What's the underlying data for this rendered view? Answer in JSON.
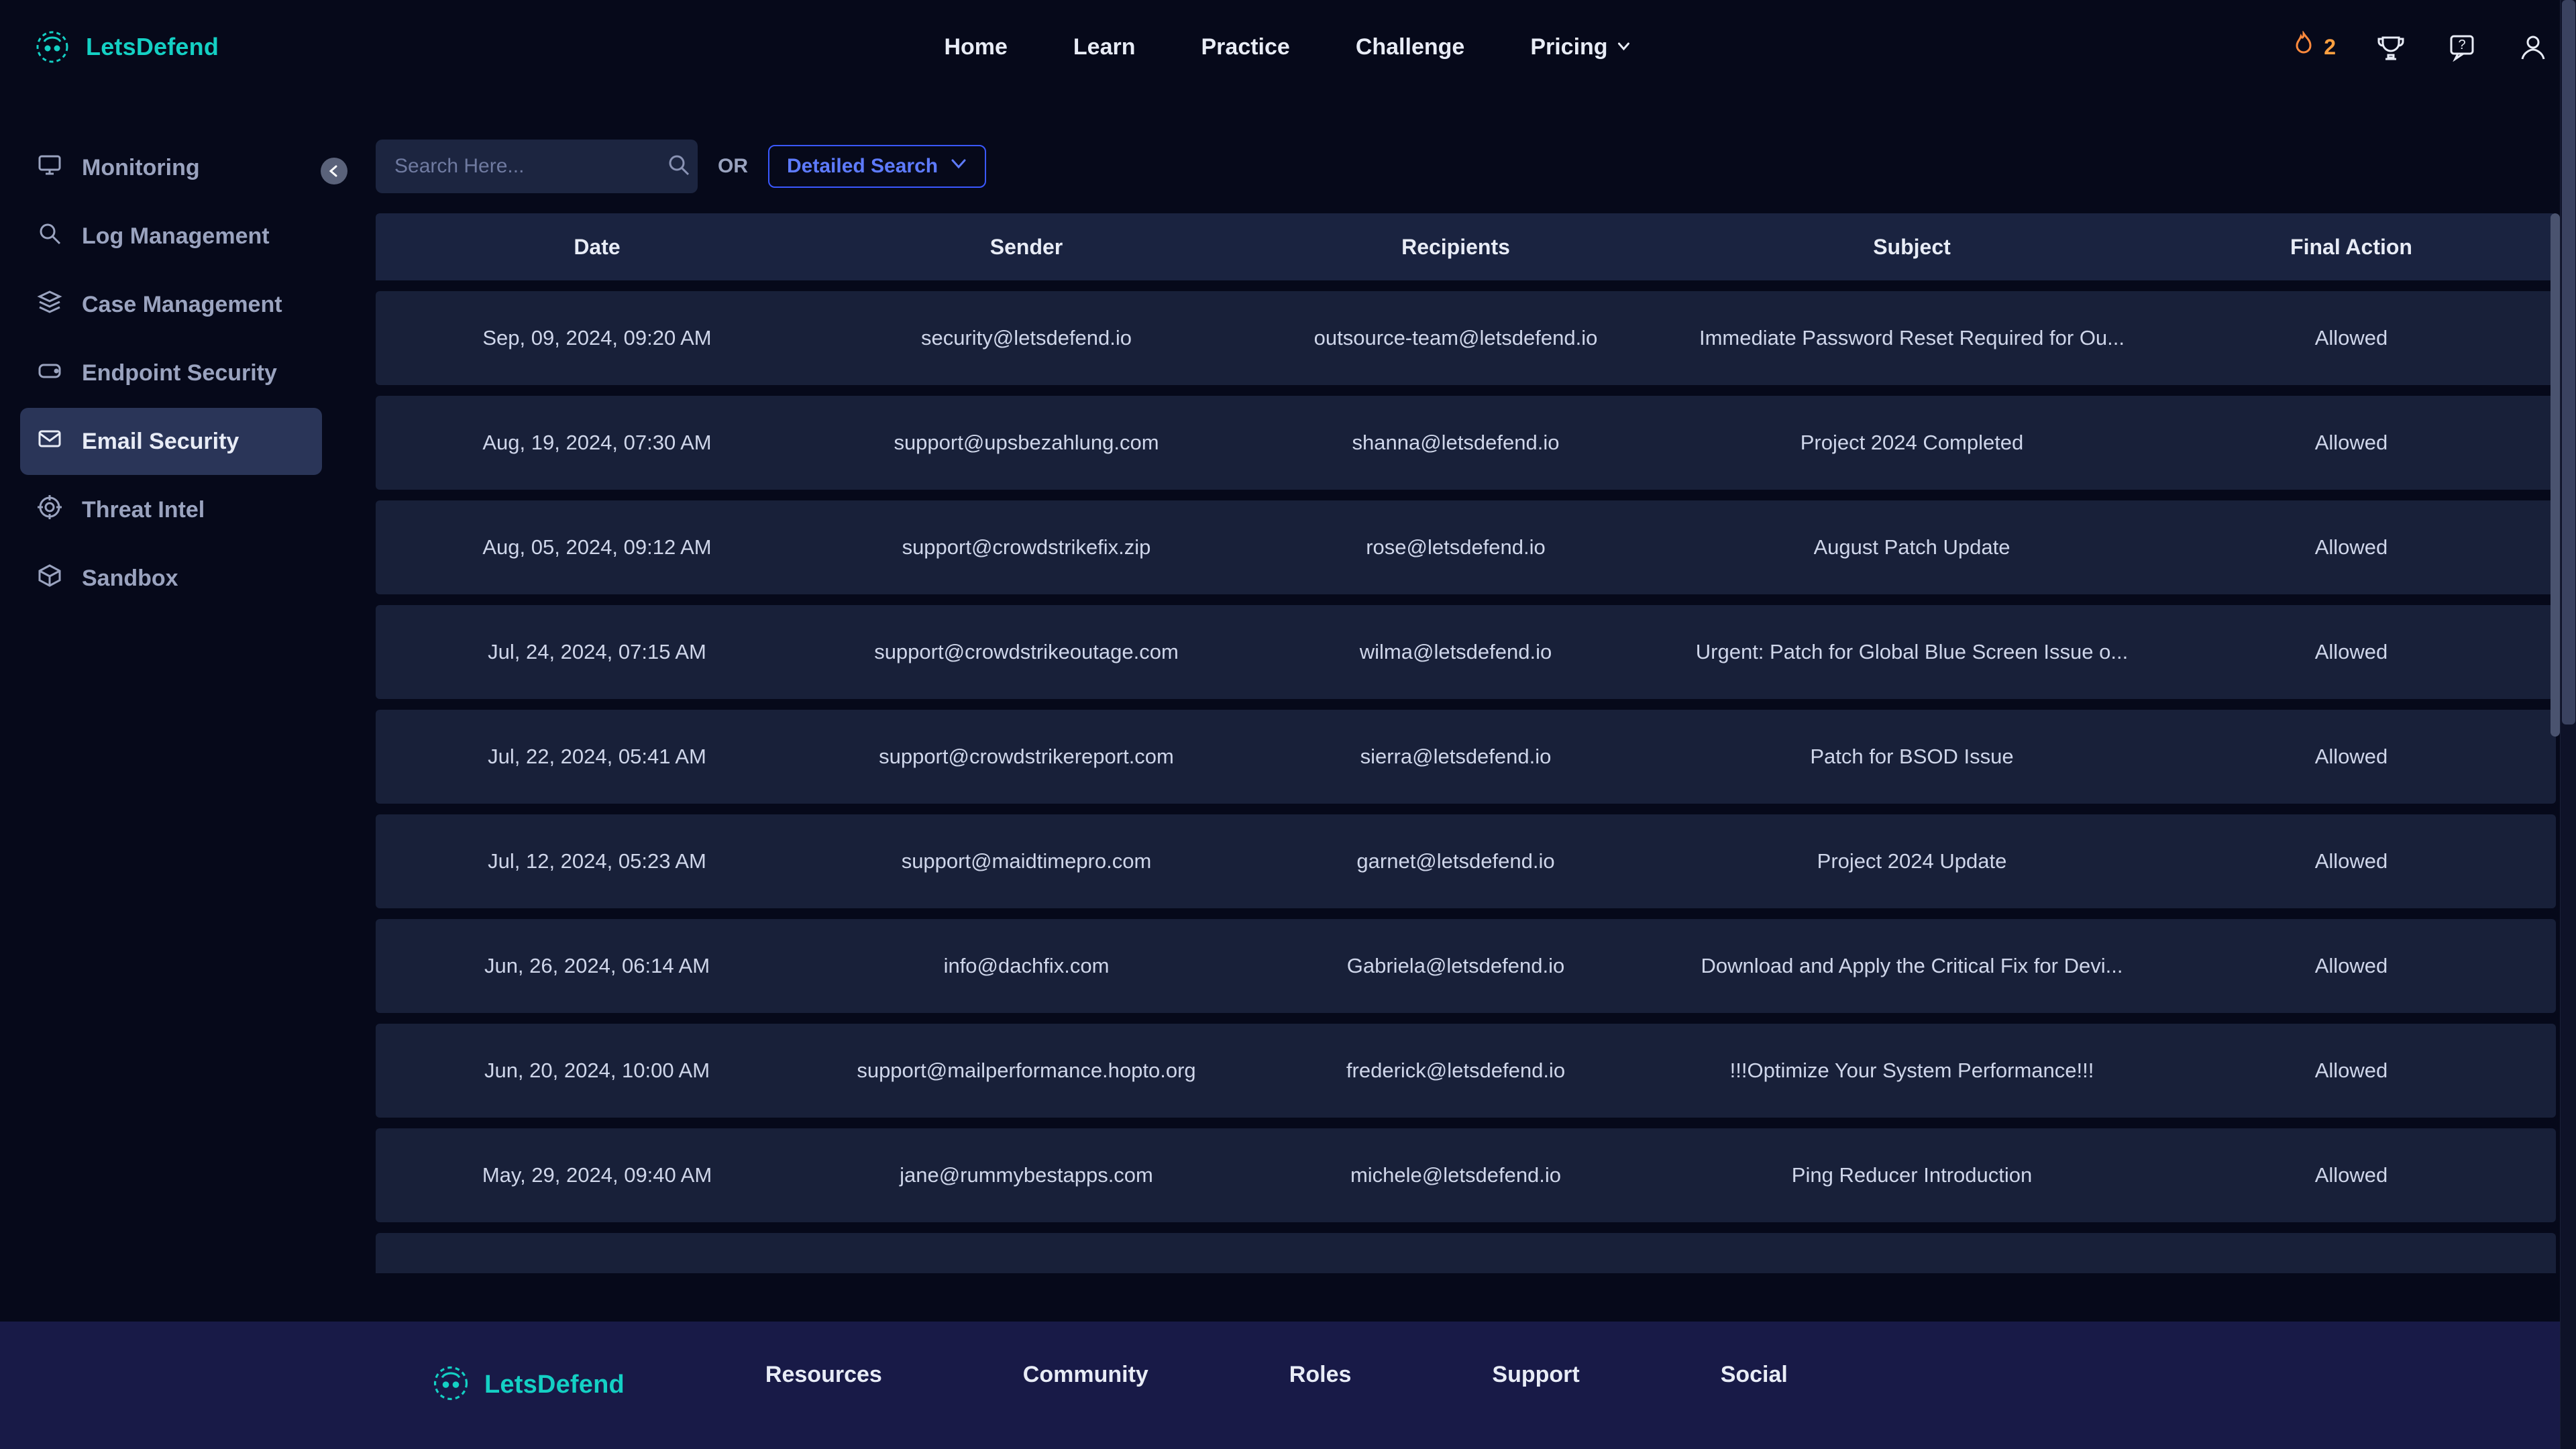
{
  "brand": "LetsDefend",
  "nav": {
    "home": "Home",
    "learn": "Learn",
    "practice": "Practice",
    "challenge": "Challenge",
    "pricing": "Pricing"
  },
  "streak_count": "2",
  "sidebar": {
    "items": [
      {
        "label": "Monitoring"
      },
      {
        "label": "Log Management"
      },
      {
        "label": "Case Management"
      },
      {
        "label": "Endpoint Security"
      },
      {
        "label": "Email Security"
      },
      {
        "label": "Threat Intel"
      },
      {
        "label": "Sandbox"
      }
    ]
  },
  "search": {
    "placeholder": "Search Here...",
    "or": "OR",
    "detailed": "Detailed Search"
  },
  "table": {
    "headers": {
      "date": "Date",
      "sender": "Sender",
      "recipients": "Recipients",
      "subject": "Subject",
      "action": "Final Action"
    },
    "rows": [
      {
        "date": "Sep, 09, 2024, 09:20 AM",
        "sender": "security@letsdefend.io",
        "recipients": "outsource-team@letsdefend.io",
        "subject": "Immediate Password Reset Required for Ou...",
        "action": "Allowed"
      },
      {
        "date": "Aug, 19, 2024, 07:30 AM",
        "sender": "support@upsbezahlung.com",
        "recipients": "shanna@letsdefend.io",
        "subject": "Project 2024 Completed",
        "action": "Allowed"
      },
      {
        "date": "Aug, 05, 2024, 09:12 AM",
        "sender": "support@crowdstrikefix.zip",
        "recipients": "rose@letsdefend.io",
        "subject": "August Patch Update",
        "action": "Allowed"
      },
      {
        "date": "Jul, 24, 2024, 07:15 AM",
        "sender": "support@crowdstrikeoutage.com",
        "recipients": "wilma@letsdefend.io",
        "subject": "Urgent: Patch for Global Blue Screen Issue o...",
        "action": "Allowed"
      },
      {
        "date": "Jul, 22, 2024, 05:41 AM",
        "sender": "support@crowdstrikereport.com",
        "recipients": "sierra@letsdefend.io",
        "subject": "Patch for BSOD Issue",
        "action": "Allowed"
      },
      {
        "date": "Jul, 12, 2024, 05:23 AM",
        "sender": "support@maidtimepro.com",
        "recipients": "garnet@letsdefend.io",
        "subject": "Project 2024 Update",
        "action": "Allowed"
      },
      {
        "date": "Jun, 26, 2024, 06:14 AM",
        "sender": "info@dachfix.com",
        "recipients": "Gabriela@letsdefend.io",
        "subject": "Download and Apply the Critical Fix for Devi...",
        "action": "Allowed"
      },
      {
        "date": "Jun, 20, 2024, 10:00 AM",
        "sender": "support@mailperformance.hopto.org",
        "recipients": "frederick@letsdefend.io",
        "subject": "!!!Optimize Your System Performance!!!",
        "action": "Allowed"
      },
      {
        "date": "May, 29, 2024, 09:40 AM",
        "sender": "jane@rummybestapps.com",
        "recipients": "michele@letsdefend.io",
        "subject": "Ping Reducer Introduction",
        "action": "Allowed"
      }
    ]
  },
  "footer": {
    "resources": "Resources",
    "community": "Community",
    "roles": "Roles",
    "support": "Support",
    "social": "Social"
  }
}
